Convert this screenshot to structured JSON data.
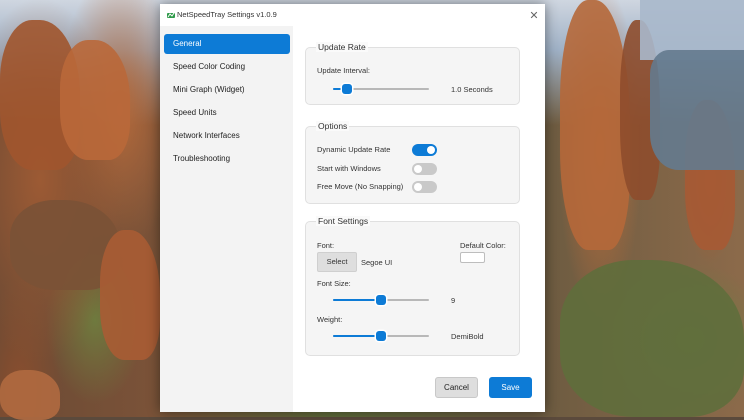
{
  "window": {
    "title": "NetSpeedTray Settings v1.0.9",
    "close_glyph": "✕"
  },
  "sidebar": {
    "items": [
      {
        "label": "General",
        "active": true
      },
      {
        "label": "Speed Color Coding",
        "active": false
      },
      {
        "label": "Mini Graph (Widget)",
        "active": false
      },
      {
        "label": "Speed Units",
        "active": false
      },
      {
        "label": "Network Interfaces",
        "active": false
      },
      {
        "label": "Troubleshooting",
        "active": false
      }
    ]
  },
  "update_rate": {
    "title": "Update Rate",
    "interval_label": "Update Interval:",
    "interval_value": "1.0 Seconds",
    "slider_fraction": 0.15
  },
  "options": {
    "title": "Options",
    "items": [
      {
        "label": "Dynamic Update Rate",
        "on": true
      },
      {
        "label": "Start with Windows",
        "on": false
      },
      {
        "label": "Free Move (No Snapping)",
        "on": false
      }
    ]
  },
  "font_settings": {
    "title": "Font Settings",
    "font_label": "Font:",
    "select_label": "Select",
    "font_name": "Segoe UI",
    "default_color_label": "Default Color:",
    "default_color": "#ffffff",
    "font_size_label": "Font Size:",
    "font_size_value": "9",
    "font_size_fraction": 0.5,
    "weight_label": "Weight:",
    "weight_value": "DemiBold",
    "weight_fraction": 0.5
  },
  "footer": {
    "cancel_label": "Cancel",
    "save_label": "Save"
  },
  "colors": {
    "accent": "#0d7bd6",
    "toggle_off": "#c9c9c9",
    "panel": "#f5f5f5"
  }
}
